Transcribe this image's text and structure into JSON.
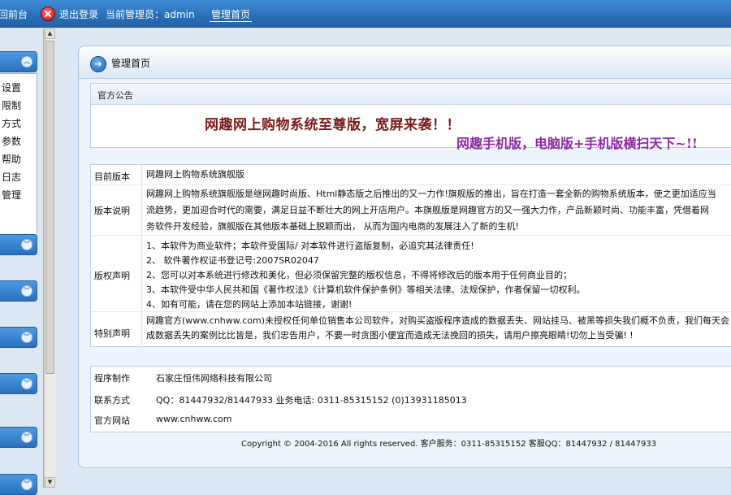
{
  "topbar": {
    "back_label": "返回前台",
    "logout_label": "退出登录",
    "current_admin": "当前管理员：admin",
    "home_link": "管理首页"
  },
  "sidebar": {
    "menu_items": [
      "设置",
      "限制",
      "方式",
      "参数",
      "帮助",
      "日志",
      "管理"
    ]
  },
  "main": {
    "title": "管理首页",
    "notice": {
      "header": "官方公告",
      "line1": "网趣网上购物系统至尊版，宽屏来袭！！",
      "line2": "网趣手机版，电脑版+手机版横扫天下~!!"
    },
    "info": {
      "version_label": "目前版本",
      "version_value": "网趣网上购物系统旗舰版",
      "desc_label": "版本说明",
      "desc_lines": [
        "网趣网上购物系统旗舰版是继网趣时尚版、Html静态版之后推出的又一力作!旗舰版的推出，旨在打造一套全新的购物系统版本，使之更加适应当",
        "流趋势，更加迎合时代的需要，满足日益不断壮大的网上开店用户。本旗舰版是网趣官方的又一强大力作，产品新颖时尚、功能丰富，凭借着网",
        "务软件开发经验，旗舰版在其他版本基础上脱颖而出， 从而为国内电商的发展注入了新的生机!"
      ],
      "copyright_label": "版权声明",
      "copyright_lines": [
        "1、本软件为商业软件；本软件受国际/                         对本软件进行盗版复制，必追究其法律责任!",
        "2、 软件著作权证书登记号:2007SR02047",
        "2、您可以对本系统进行修改和美化，但必须保留完整的版权信息，不得将修改后的版本用于任何商业目的；",
        "3、本软件受中华人民共和国《著作权法》《计算机软件保护条例》等相关法律、法规保护，作者保留一切权利。",
        "4、如有可能，请在您的网站上添加本站链接，谢谢!"
      ],
      "special_label": "特别声明",
      "special_lines": [
        "网趣官方(www.cnhww.com)未授权任何单位销售本公司软件，对购买盗版程序造成的数据丢失、网站挂马、被黑等损失我们概不负责，我们每天会",
        "成数据丢失的案例比比皆是，我们忠告用户，不要一时贪图小便宜而造成无法挽回的损失，请用户擦亮眼睛!切勿上当受骗! !"
      ]
    },
    "contact": {
      "maker_label": "程序制作",
      "maker_value": "石家庄恒伟网络科技有限公司",
      "phone_label": "联系方式",
      "phone_value": "QQ：81447932/81447933 业务电话: 0311-85315152 (0)13931185013",
      "site_label": "官方网站",
      "site_value": "www.cnhww.com"
    },
    "footer": "Copyright © 2004-2016 All rights reserved. 客户服务：0311-85315152 客服QQ：81447932 / 81447933"
  },
  "icons": {
    "logout": "close-circle-icon",
    "home_arrow": "arrow-right-circle-icon",
    "chevron_up": "chevron-up-icon",
    "chevron_down": "chevron-down-icon"
  }
}
